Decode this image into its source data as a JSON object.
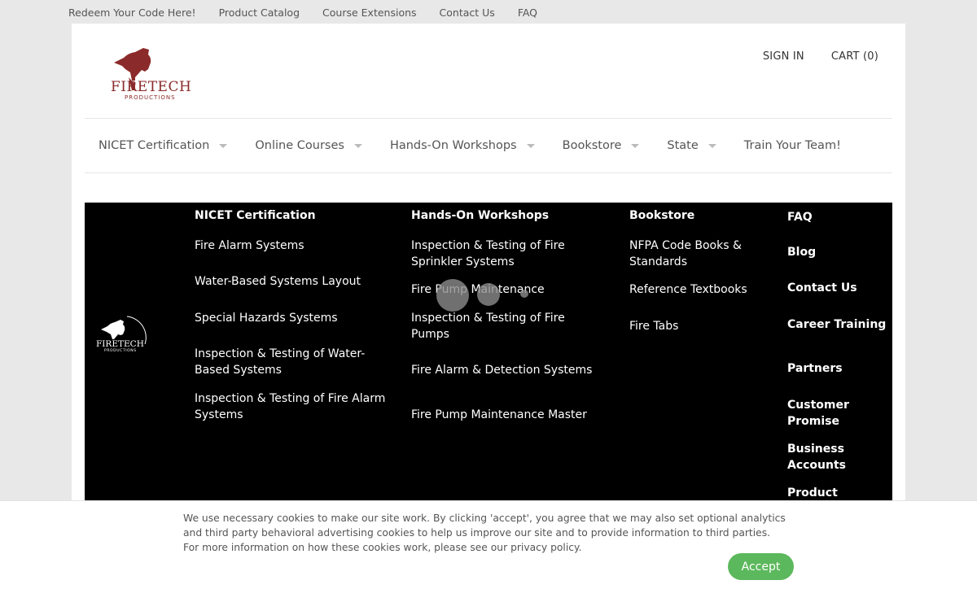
{
  "top_links": [
    "Redeem Your Code Here!",
    "Product Catalog",
    "Course Extensions",
    "Contact Us",
    "FAQ"
  ],
  "brand": {
    "name": "FIRETECH",
    "sub": "PRODUCTIONS",
    "color": "#8b2a2a"
  },
  "account": {
    "sign_in": "SIGN IN",
    "cart": "CART (0)"
  },
  "nav": [
    {
      "label": "NICET Certification",
      "dropdown": true
    },
    {
      "label": "Online Courses",
      "dropdown": true
    },
    {
      "label": "Hands-On Workshops",
      "dropdown": true
    },
    {
      "label": "Bookstore",
      "dropdown": true
    },
    {
      "label": "State",
      "dropdown": true
    },
    {
      "label": "Train Your Team!",
      "dropdown": false
    }
  ],
  "footer": {
    "nicet": {
      "heading": "NICET Certification",
      "links": [
        "Fire Alarm Systems",
        "Water-Based Systems Layout",
        "Special Hazards Systems",
        "Inspection & Testing of Water-Based Systems",
        "Inspection & Testing of Fire Alarm Systems"
      ]
    },
    "hands_on": {
      "heading": "Hands-On Workshops",
      "links": [
        "Inspection & Testing of Fire Sprinkler Systems",
        "Fire Pump Maintenance",
        "Inspection & Testing of Fire Pumps",
        "Fire Alarm & Detection Systems",
        "Fire Pump Maintenance Master"
      ]
    },
    "bookstore": {
      "heading": "Bookstore",
      "links": [
        "NFPA Code Books & Standards",
        "Reference Textbooks",
        "Fire Tabs"
      ]
    },
    "misc": {
      "heading": "FAQ",
      "links": [
        "Blog",
        "Contact Us",
        "Career Training",
        "Partners",
        "Customer Promise",
        "Business Accounts",
        "Product"
      ]
    }
  },
  "cookie": {
    "text": "We use necessary cookies to make our site work. By clicking 'accept', you agree that we may also set optional analytics and third party behavioral advertising cookies to help us improve our site and to provide information to third parties. For more information on how these cookies work, please see our privacy policy.",
    "accept": "Accept",
    "accept_color": "#5cb85c"
  }
}
